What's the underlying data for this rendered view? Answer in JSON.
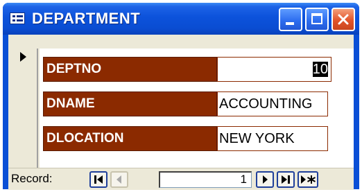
{
  "window": {
    "title": "DEPARTMENT"
  },
  "fields": [
    {
      "label": "DEPTNO",
      "value": "10"
    },
    {
      "label": "DNAME",
      "value": "ACCOUNTING"
    },
    {
      "label": "DLOCATION",
      "value": "NEW YORK"
    }
  ],
  "navigation": {
    "record_label": "Record:",
    "current_record": "1"
  },
  "icons": {
    "form": "form-icon",
    "first": "first-record-icon",
    "previous": "previous-record-icon",
    "next": "next-record-icon",
    "last": "last-record-icon",
    "new": "new-record-icon"
  },
  "colors": {
    "titlebar": "#0c52db",
    "label_bg": "#8b2a00",
    "close_button": "#e2542a"
  }
}
